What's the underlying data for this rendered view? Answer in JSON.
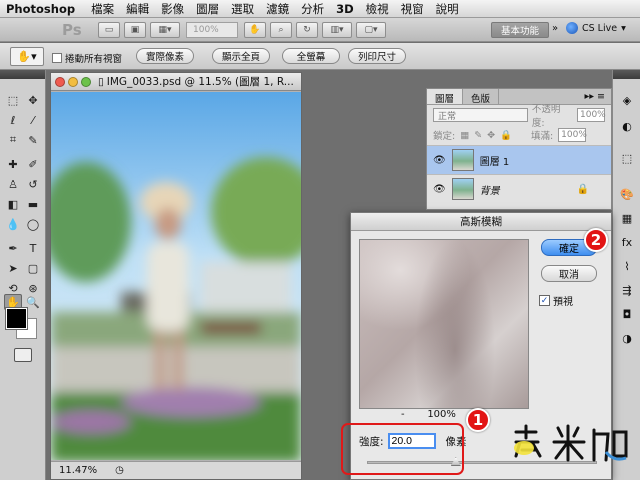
{
  "menubar": {
    "app": "Photoshop",
    "items": [
      "檔案",
      "編輯",
      "影像",
      "圖層",
      "選取",
      "濾鏡",
      "分析",
      "3D",
      "檢視",
      "視窗",
      "說明"
    ]
  },
  "appbar": {
    "ps_logo": "Ps",
    "zoom": "100%",
    "workspace": "基本功能",
    "cslive": "CS Live"
  },
  "options": {
    "scroll_all": "捲動所有視窗",
    "actual_pixels": "實際像素",
    "fit_screen": "顯示全頁",
    "fill_screen": "全螢幕",
    "print_size": "列印尺寸"
  },
  "document": {
    "title": "IMG_0033.psd @ 11.5% (圖層 1, R...",
    "zoom": "11.47%"
  },
  "layers_panel": {
    "tabs": [
      "圖層",
      "色版"
    ],
    "blend_mode": "正常",
    "opacity_label": "不透明度:",
    "opacity": "100%",
    "lock_label": "鎖定:",
    "fill_label": "填滿:",
    "fill": "100%",
    "layers": [
      {
        "name": "圖層 1",
        "selected": true
      },
      {
        "name": "背景",
        "selected": false
      }
    ]
  },
  "gaussian_blur": {
    "title": "高斯模糊",
    "ok": "確定",
    "cancel": "取消",
    "preview_label": "預視",
    "preview_checked": true,
    "preview_zoom": "100%",
    "zoom_out": "-",
    "zoom_in": "+",
    "radius_label": "強度:",
    "radius": "20.0",
    "unit": "像素",
    "slider_fraction": 0.38
  },
  "annotations": {
    "step1": "1",
    "step2": "2",
    "color": "#e21414"
  },
  "watermark": "奧米加"
}
